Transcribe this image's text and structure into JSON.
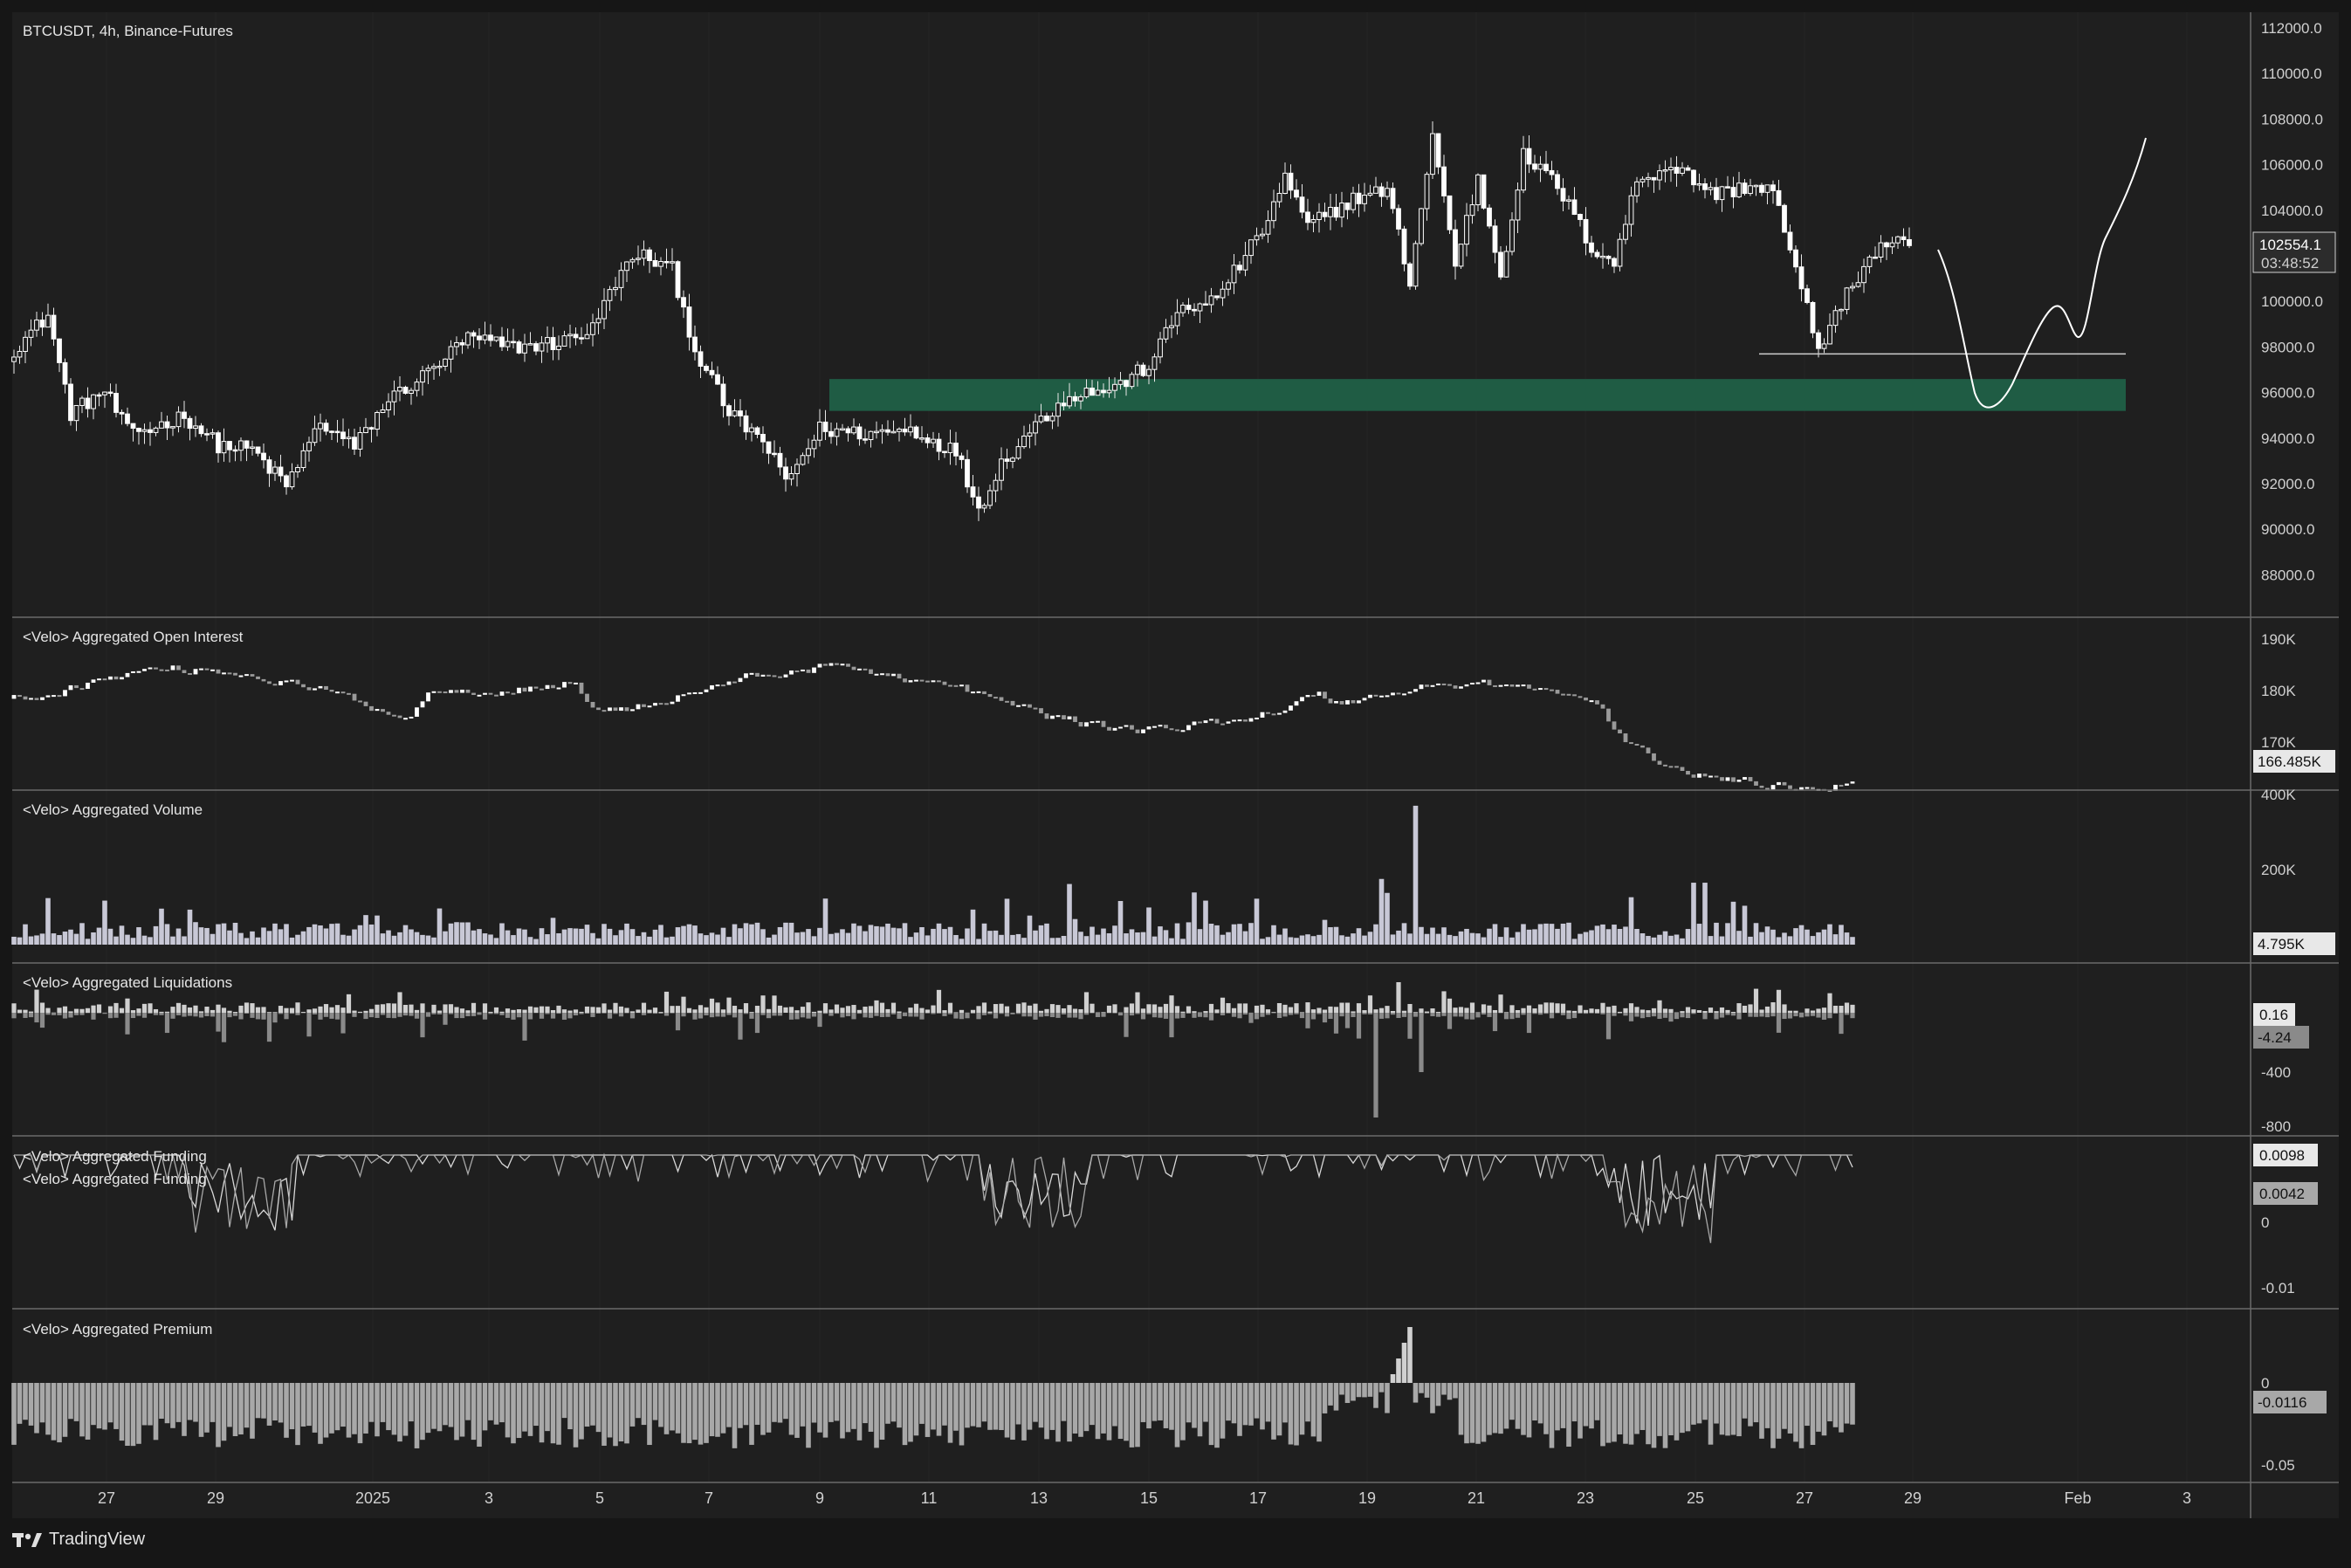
{
  "main_pane": {
    "symbol_label": "BTCUSDT, 4h, Binance-Futures",
    "price_ticks": [
      "112000.0",
      "110000.0",
      "108000.0",
      "106000.0",
      "104000.0",
      "102000.0",
      "100000.0",
      "98000.0",
      "96000.0",
      "94000.0",
      "92000.0",
      "90000.0",
      "88000.0"
    ],
    "last_price": "102554.1",
    "countdown": "03:48:52",
    "zone_color": "#1f5c44",
    "ohlc_anchors": [
      [
        0,
        98000
      ],
      [
        6,
        99500
      ],
      [
        10,
        95200
      ],
      [
        16,
        96200
      ],
      [
        20,
        94400
      ],
      [
        24,
        94500
      ],
      [
        30,
        95100
      ],
      [
        36,
        93800
      ],
      [
        42,
        93600
      ],
      [
        48,
        92000
      ],
      [
        54,
        94800
      ],
      [
        60,
        93700
      ],
      [
        66,
        95800
      ],
      [
        72,
        96800
      ],
      [
        80,
        98500
      ],
      [
        88,
        98100
      ],
      [
        96,
        98300
      ],
      [
        102,
        98900
      ],
      [
        106,
        101000
      ],
      [
        110,
        102200
      ],
      [
        116,
        101500
      ],
      [
        120,
        98000
      ],
      [
        126,
        95200
      ],
      [
        132,
        94000
      ],
      [
        136,
        92200
      ],
      [
        142,
        94500
      ],
      [
        150,
        94300
      ],
      [
        158,
        94500
      ],
      [
        166,
        93500
      ],
      [
        170,
        91000
      ],
      [
        174,
        93000
      ],
      [
        180,
        94700
      ],
      [
        186,
        96000
      ],
      [
        194,
        96300
      ],
      [
        200,
        97300
      ],
      [
        206,
        100000
      ],
      [
        210,
        99800
      ],
      [
        214,
        101000
      ],
      [
        220,
        103200
      ],
      [
        224,
        105500
      ],
      [
        228,
        103400
      ],
      [
        236,
        104600
      ],
      [
        242,
        105000
      ],
      [
        246,
        101000
      ],
      [
        250,
        107400
      ],
      [
        254,
        101800
      ],
      [
        258,
        105500
      ],
      [
        262,
        101300
      ],
      [
        266,
        106500
      ],
      [
        272,
        105200
      ],
      [
        278,
        102500
      ],
      [
        282,
        101800
      ],
      [
        286,
        105400
      ],
      [
        292,
        106100
      ],
      [
        300,
        104800
      ],
      [
        306,
        105200
      ],
      [
        310,
        105000
      ],
      [
        314,
        101400
      ],
      [
        318,
        98100
      ],
      [
        322,
        99900
      ],
      [
        326,
        101700
      ],
      [
        330,
        102700
      ],
      [
        334,
        102554
      ]
    ],
    "forecast_path": "down to ~95300 then up to ~107300",
    "support_level": 97800,
    "zone_low": 95300,
    "zone_high": 96700
  },
  "panes": {
    "open_interest": {
      "label": "<Velo> Aggregated Open Interest",
      "ticks": [
        "190K",
        "180K",
        "170K"
      ],
      "badge": "166.485K"
    },
    "volume": {
      "label": "<Velo> Aggregated Volume",
      "ticks": [
        "400K",
        "200K"
      ],
      "badge": "4.795K"
    },
    "liquidations": {
      "label": "<Velo> Aggregated Liquidations",
      "ticks": [
        "-400",
        "-800"
      ],
      "badge_top": "0.16",
      "badge_bottom": "-4.24"
    },
    "funding": {
      "label_1": "<Velo> Aggregated Funding",
      "label_2": "<Velo> Aggregated Funding",
      "ticks": [
        "0",
        "-0.01"
      ],
      "badge_top": "0.0098",
      "badge_bottom": "0.0042"
    },
    "premium": {
      "label": "<Velo> Aggregated Premium",
      "ticks": [
        "0",
        "-0.05"
      ],
      "badge": "-0.0116"
    }
  },
  "time_axis": {
    "labels": [
      "27",
      "29",
      "2025",
      "3",
      "5",
      "7",
      "9",
      "11",
      "13",
      "15",
      "17",
      "19",
      "21",
      "23",
      "25",
      "27",
      "29",
      "Feb",
      "3"
    ]
  },
  "branding": {
    "name": "TradingView"
  },
  "colors": {
    "background": "#1f1f1f",
    "candle_up": "#ffffff",
    "candle_down": "#ffffff",
    "grid": "#2a2a2a",
    "separator": "#5a5a5a"
  }
}
